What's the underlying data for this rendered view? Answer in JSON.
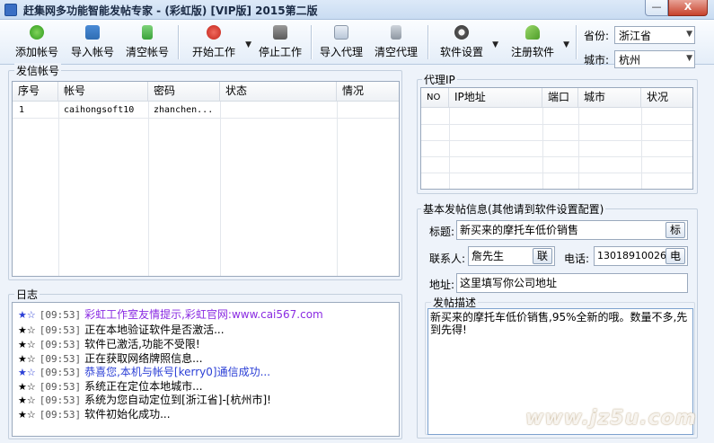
{
  "window": {
    "title": "赶集网多功能智能发帖专家 - (彩虹版)   [VIP版]   2015第二版",
    "min_label": "—",
    "close_label": "X"
  },
  "toolbar": {
    "buttons": [
      {
        "label": "添加帐号",
        "icon": "add-circle-icon"
      },
      {
        "label": "导入帐号",
        "icon": "import-icon"
      },
      {
        "label": "清空帐号",
        "icon": "trash-icon"
      },
      {
        "label": "开始工作",
        "icon": "play-icon"
      },
      {
        "label": "停止工作",
        "icon": "stop-icon"
      },
      {
        "label": "导入代理",
        "icon": "import-proxy-icon"
      },
      {
        "label": "清空代理",
        "icon": "trash-icon"
      },
      {
        "label": "软件设置",
        "icon": "gear-icon"
      },
      {
        "label": "注册软件",
        "icon": "key-icon"
      }
    ],
    "province_label": "省份:",
    "province_value": "浙江省",
    "city_label": "城市:",
    "city_value": "杭州"
  },
  "accounts": {
    "group_label": "发信帐号",
    "columns": [
      "序号",
      "帐号",
      "密码",
      "状态",
      "情况"
    ],
    "rows": [
      {
        "index": "1",
        "account": "caihongsoft10",
        "password": "zhanchen...",
        "status": "",
        "situation": ""
      }
    ]
  },
  "proxy": {
    "group_label": "代理IP",
    "columns": [
      "NO",
      "IP地址",
      "端口",
      "城市",
      "状况"
    ]
  },
  "post_info": {
    "group_label": "基本发帖信息(其他请到软件设置配置)",
    "title_label": "标题:",
    "title_value": "新买来的摩托车低价销售",
    "title_btn": "标",
    "contact_label": "联系人:",
    "contact_value": "詹先生",
    "contact_btn": "联",
    "phone_label": "电话:",
    "phone_value": "13018910026",
    "phone_btn": "电",
    "address_label": "地址:",
    "address_value": "这里填写你公司地址",
    "desc_label": "发帖描述",
    "desc_value": "新买来的摩托车低价销售,95%全新的哦。数量不多,先到先得!"
  },
  "log": {
    "group_label": "日志",
    "lines": [
      {
        "time": "[09:53]",
        "text": "彩虹工作室友情提示,彩虹官网:www.cai567.com",
        "color": "#8a2be2"
      },
      {
        "time": "[09:53]",
        "text": "正在本地验证软件是否激活...",
        "color": "#000000"
      },
      {
        "time": "[09:53]",
        "text": "软件已激活,功能不受限!",
        "color": "#000000"
      },
      {
        "time": "[09:53]",
        "text": "正在获取网络牌照信息...",
        "color": "#000000"
      },
      {
        "time": "[09:53]",
        "text": "恭喜您,本机与帐号[kerry0]通信成功...",
        "color": "#2b3fd6"
      },
      {
        "time": "[09:53]",
        "text": "系统正在定位本地城市...",
        "color": "#000000"
      },
      {
        "time": "[09:53]",
        "text": "系统为您自动定位到[浙江省]-[杭州市]!",
        "color": "#000000"
      },
      {
        "time": "[09:53]",
        "text": "软件初始化成功...",
        "color": "#000000"
      }
    ],
    "star_label": "★☆"
  },
  "watermark": "www.jz5u.com"
}
